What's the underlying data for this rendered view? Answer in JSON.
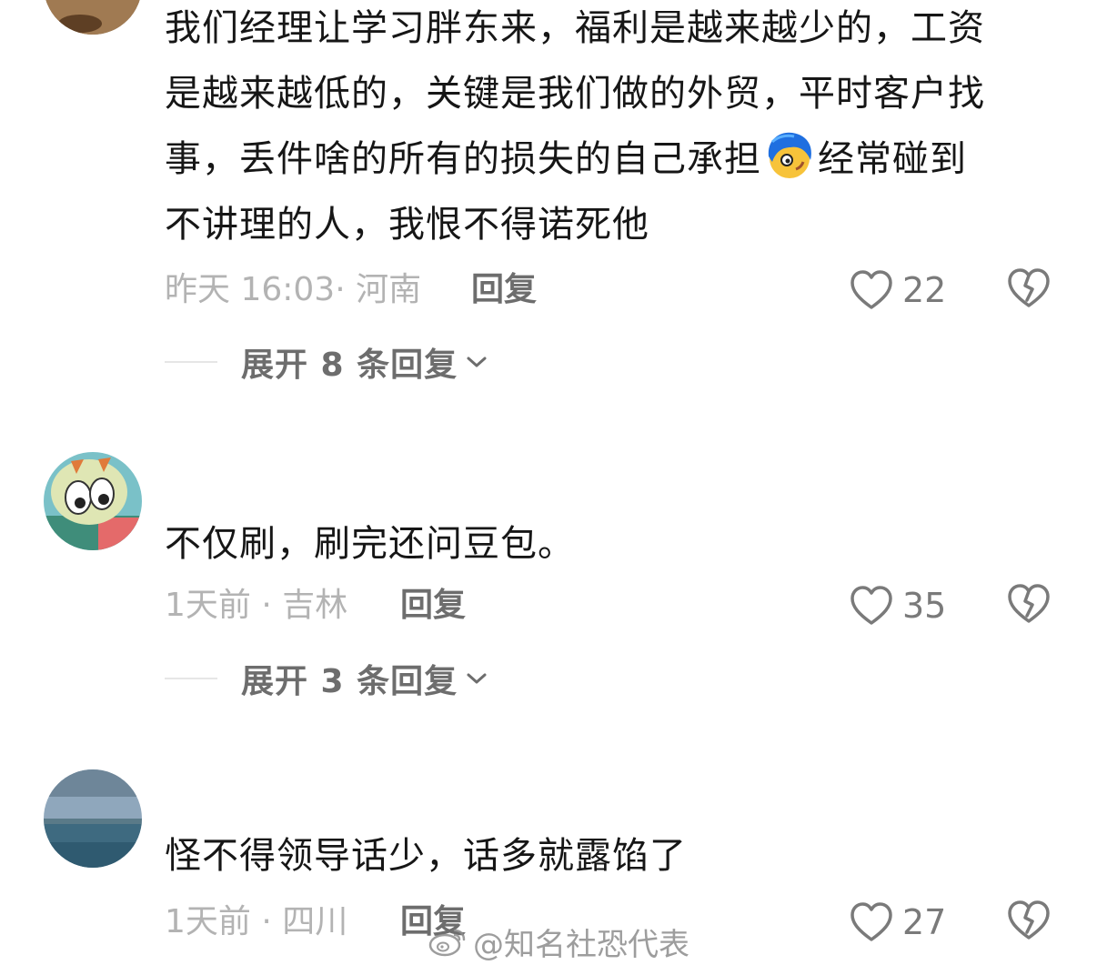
{
  "comments": [
    {
      "text_lines": [
        "我们经理让学习胖东来，福利是越来越少的，工资",
        "是越来越低的，关键是我们做的外贸，平时客户找",
        "事，丢件啥的所有的损失的自己承担",
        "经常碰到",
        "不讲理的人，我恨不得诺死他"
      ],
      "time": "昨天 16:03",
      "location": "河南",
      "reply_label": "回复",
      "likes": "22",
      "expand_label": "展开 8 条回复"
    },
    {
      "text": "不仅刷，刷完还问豆包。",
      "time": "1天前",
      "location": "吉林",
      "reply_label": "回复",
      "likes": "35",
      "expand_label": "展开 3 条回复"
    },
    {
      "text": "怪不得领导话少，话多就露馅了",
      "time": "1天前",
      "location": "四川",
      "reply_label": "回复",
      "likes": "27"
    }
  ],
  "meta_separator": "·",
  "watermark": "@知名社恐代表",
  "icons": {
    "like": "heart-outline-icon",
    "dislike": "broken-heart-icon",
    "expand": "chevron-down-icon",
    "watermark": "weibo-logo-icon",
    "inline_emoji": "blue-hair-face-emoji"
  },
  "colors": {
    "text": "#161616",
    "meta": "#b3b3b3",
    "action": "#6d6d6d",
    "icon": "#7a7a7a"
  }
}
